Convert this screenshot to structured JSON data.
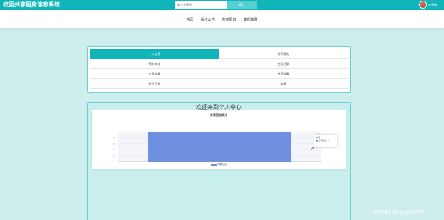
{
  "header": {
    "brand": "校园共享厨房信息系统",
    "search_placeholder": "输入关键词",
    "search_button": "搜",
    "username": "李雪梅"
  },
  "nav": {
    "items": [
      "首页",
      "系统公告",
      "共享厨房",
      "变现故事"
    ]
  },
  "personal_menu": {
    "items": [
      {
        "label": "个人信息",
        "active": true
      },
      {
        "label": "共享厨房"
      },
      {
        "label": "预约审核"
      },
      {
        "label": "使用记录"
      },
      {
        "label": "变现故事"
      },
      {
        "label": "共享故事"
      },
      {
        "label": "积分记录"
      },
      {
        "label": "收藏"
      }
    ]
  },
  "center": {
    "title": "欢迎来到个人中心"
  },
  "chart_data": {
    "type": "bar",
    "title": "共享厨房统计",
    "categories": [
      "中厨"
    ],
    "series": [
      {
        "name": "中厨数量",
        "values": [
          1
        ]
      }
    ],
    "ylim": [
      0,
      1
    ],
    "yticks": [
      "0",
      "0.2",
      "0.4",
      "0.6",
      "0.8",
      "1"
    ],
    "tooltip": {
      "category": "中厨",
      "series": "中厨数量",
      "value": "1"
    },
    "legend": "中厨数量",
    "colors": {
      "bar": "#6f8fe0"
    }
  },
  "watermark": "CSDN @bysjlw985"
}
